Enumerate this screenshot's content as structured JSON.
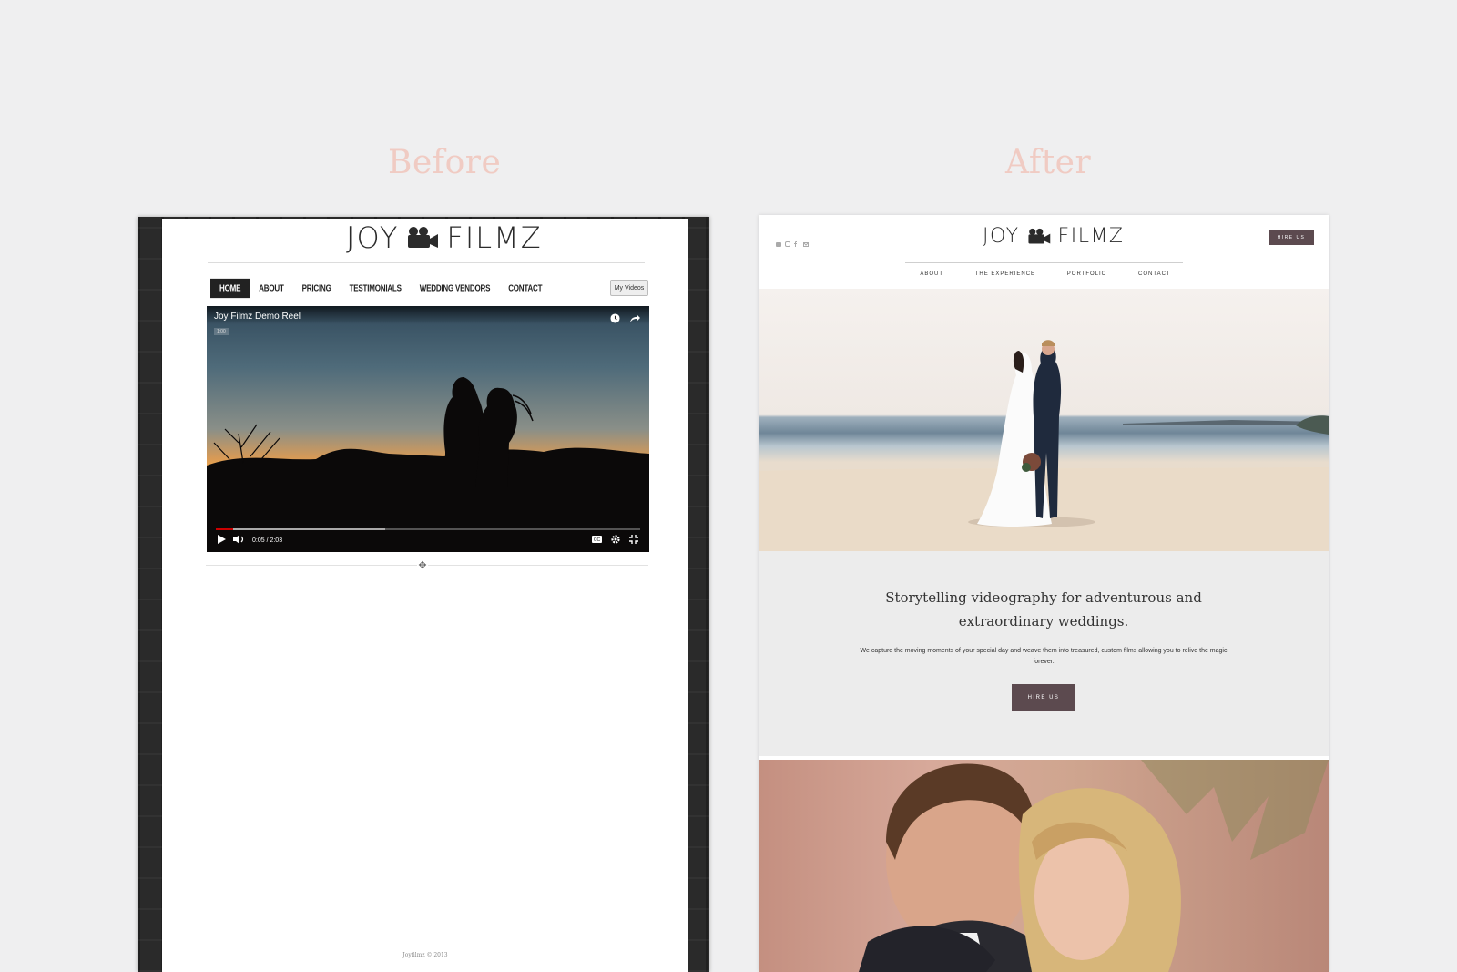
{
  "captions": {
    "before": "Before",
    "after": "After"
  },
  "before": {
    "logo": {
      "left": "JOY",
      "right": "FILMZ"
    },
    "nav": [
      {
        "label": "HOME",
        "active": true
      },
      {
        "label": "ABOUT"
      },
      {
        "label": "PRICING"
      },
      {
        "label": "TESTIMONIALS"
      },
      {
        "label": "WEDDING VENDORS"
      },
      {
        "label": "CONTACT"
      }
    ],
    "my_videos": "My Videos",
    "video": {
      "title": "Joy Filmz Demo Reel",
      "badge": "1:00",
      "time": "0:05 / 2:03",
      "progress": 0.04,
      "buffered": 0.4
    },
    "footer": "Joyfilmz © 2013"
  },
  "after": {
    "logo": {
      "left": "JOY",
      "right": "FILMZ"
    },
    "social_icons": [
      "youtube-icon",
      "instagram-icon",
      "facebook-icon",
      "email-icon"
    ],
    "hire_top": "HIRE US",
    "nav": [
      "ABOUT",
      "THE EXPERIENCE",
      "PORTFOLIO",
      "CONTACT"
    ],
    "headline_line1": "Storytelling videography for adventurous and",
    "headline_line2": "extraordinary weddings.",
    "body": "We capture the moving moments of your special day and weave them into treasured, custom films allowing you to relive the magic forever.",
    "hire_mid": "HIRE US"
  },
  "colors": {
    "caption": "#f0cbc3",
    "button": "#5c4a4f",
    "video_progress": "#cc0000"
  }
}
